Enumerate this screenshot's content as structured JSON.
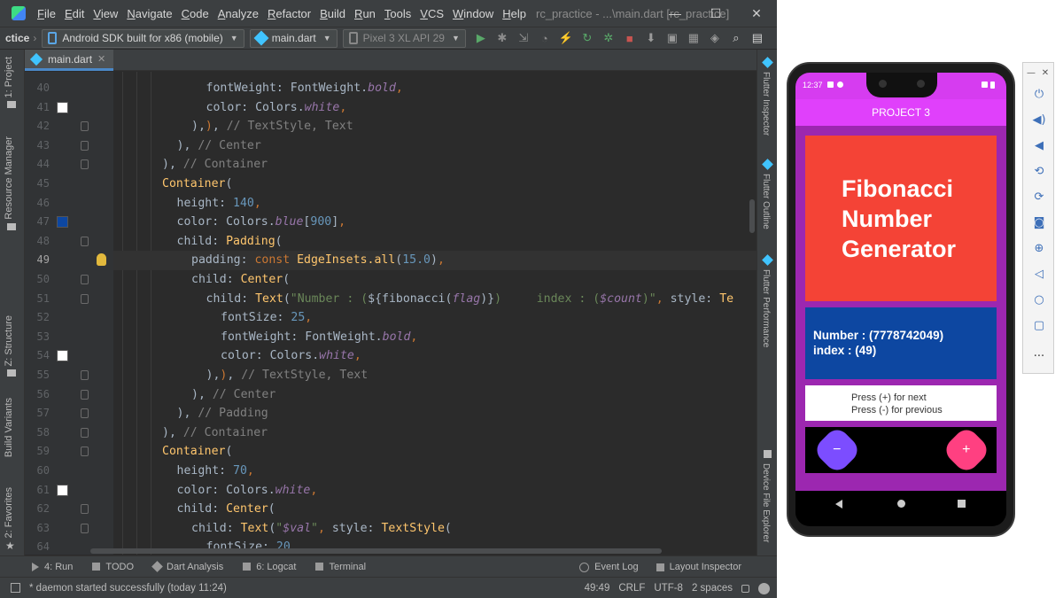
{
  "ide": {
    "menu": [
      "File",
      "Edit",
      "View",
      "Navigate",
      "Code",
      "Analyze",
      "Refactor",
      "Build",
      "Run",
      "Tools",
      "VCS",
      "Window",
      "Help"
    ],
    "window_title": "rc_practice - ...\\main.dart [rc_practice]",
    "window_buttons": {
      "minimize": "—",
      "maximize": "☐",
      "close": "✕"
    },
    "toolbar": {
      "breadcrumb": "ctice",
      "device_target": "Android SDK built for x86 (mobile)",
      "run_config": "main.dart",
      "avd": "Pixel 3 XL API 29",
      "icons": [
        "run-icon",
        "debug-icon",
        "attach-icon",
        "profile-icon",
        "hot-reload-icon",
        "hot-restart-icon",
        "flutter-debug-icon",
        "stop-icon",
        "sdk-manager-icon",
        "avd-manager-icon",
        "project-structure-icon",
        "search-icon",
        "user-icon"
      ]
    },
    "editor_tab": "main.dart",
    "left_tools": [
      "1: Project",
      "Resource Manager",
      "Z: Structure",
      "Build Variants",
      "2: Favorites"
    ],
    "right_tools": [
      "Flutter Inspector",
      "Flutter Outline",
      "Flutter Performance",
      "Device File Explorer"
    ],
    "code_lines": [
      {
        "n": "40",
        "swatch": "",
        "fold": false,
        "bulb": false,
        "cur": false,
        "indent": 4,
        "tokens": [
          {
            "c": "pl",
            "t": "fontWeight: FontWeight."
          },
          {
            "c": "it",
            "t": "bold"
          },
          {
            "c": "kw",
            "t": ","
          }
        ]
      },
      {
        "n": "41",
        "swatch": "#ffffff",
        "fold": false,
        "bulb": false,
        "cur": false,
        "indent": 4,
        "tokens": [
          {
            "c": "pl",
            "t": "color: Colors."
          },
          {
            "c": "it",
            "t": "white"
          },
          {
            "c": "kw",
            "t": ","
          }
        ]
      },
      {
        "n": "42",
        "swatch": "",
        "fold": true,
        "bulb": false,
        "cur": false,
        "indent": 3,
        "tokens": [
          {
            "c": "pl",
            "t": "),"
          },
          {
            "c": "kw",
            "t": ")"
          },
          {
            "c": "pl",
            "t": ","
          },
          {
            "c": "cm",
            "t": " // TextStyle, Text"
          }
        ]
      },
      {
        "n": "43",
        "swatch": "",
        "fold": true,
        "bulb": false,
        "cur": false,
        "indent": 2,
        "tokens": [
          {
            "c": "pl",
            "t": "),"
          },
          {
            "c": "cm",
            "t": " // Center"
          }
        ]
      },
      {
        "n": "44",
        "swatch": "",
        "fold": true,
        "bulb": false,
        "cur": false,
        "indent": 1,
        "tokens": [
          {
            "c": "pl",
            "t": "),"
          },
          {
            "c": "cm",
            "t": " // Container"
          }
        ]
      },
      {
        "n": "45",
        "swatch": "",
        "fold": false,
        "bulb": false,
        "cur": false,
        "indent": 1,
        "tokens": [
          {
            "c": "fn",
            "t": "Container"
          },
          {
            "c": "pl",
            "t": "("
          }
        ]
      },
      {
        "n": "46",
        "swatch": "",
        "fold": false,
        "bulb": false,
        "cur": false,
        "indent": 2,
        "tokens": [
          {
            "c": "pl",
            "t": "height: "
          },
          {
            "c": "num",
            "t": "140"
          },
          {
            "c": "kw",
            "t": ","
          }
        ]
      },
      {
        "n": "47",
        "swatch": "#0d47a1",
        "fold": false,
        "bulb": false,
        "cur": false,
        "indent": 2,
        "tokens": [
          {
            "c": "pl",
            "t": "color: Colors."
          },
          {
            "c": "it",
            "t": "blue"
          },
          {
            "c": "pl",
            "t": "["
          },
          {
            "c": "num",
            "t": "900"
          },
          {
            "c": "pl",
            "t": "]"
          },
          {
            "c": "kw",
            "t": ","
          }
        ]
      },
      {
        "n": "48",
        "swatch": "",
        "fold": true,
        "bulb": false,
        "cur": false,
        "indent": 2,
        "tokens": [
          {
            "c": "pl",
            "t": "child: "
          },
          {
            "c": "fn",
            "t": "Padding"
          },
          {
            "c": "pl",
            "t": "("
          }
        ]
      },
      {
        "n": "49",
        "swatch": "",
        "fold": false,
        "bulb": true,
        "cur": true,
        "indent": 3,
        "tokens": [
          {
            "c": "pl",
            "t": "padding: "
          },
          {
            "c": "kw",
            "t": "const "
          },
          {
            "c": "fn",
            "t": "EdgeInsets.all"
          },
          {
            "c": "pl",
            "t": "("
          },
          {
            "c": "num",
            "t": "15.0"
          },
          {
            "c": "pl",
            "t": ")"
          },
          {
            "c": "kw",
            "t": ","
          }
        ]
      },
      {
        "n": "50",
        "swatch": "",
        "fold": true,
        "bulb": false,
        "cur": false,
        "indent": 3,
        "tokens": [
          {
            "c": "pl",
            "t": "child: "
          },
          {
            "c": "fn",
            "t": "Center"
          },
          {
            "c": "pl",
            "t": "("
          }
        ]
      },
      {
        "n": "51",
        "swatch": "",
        "fold": true,
        "bulb": false,
        "cur": false,
        "indent": 4,
        "tokens": [
          {
            "c": "pl",
            "t": "child: "
          },
          {
            "c": "fn",
            "t": "Text"
          },
          {
            "c": "pl",
            "t": "("
          },
          {
            "c": "str",
            "t": "\"Number : ("
          },
          {
            "c": "pl",
            "t": "${"
          },
          {
            "c": "pl",
            "t": "fibonacci("
          },
          {
            "c": "it",
            "t": "flag"
          },
          {
            "c": "pl",
            "t": ")}"
          },
          {
            "c": "str",
            "t": ")     index : ("
          },
          {
            "c": "it",
            "t": "$count"
          },
          {
            "c": "str",
            "t": ")\""
          },
          {
            "c": "kw",
            "t": ","
          },
          {
            "c": "pl",
            "t": " style: "
          },
          {
            "c": "fn",
            "t": "Te"
          }
        ]
      },
      {
        "n": "52",
        "swatch": "",
        "fold": false,
        "bulb": false,
        "cur": false,
        "indent": 5,
        "tokens": [
          {
            "c": "pl",
            "t": "fontSize: "
          },
          {
            "c": "num",
            "t": "25"
          },
          {
            "c": "kw",
            "t": ","
          }
        ]
      },
      {
        "n": "53",
        "swatch": "",
        "fold": false,
        "bulb": false,
        "cur": false,
        "indent": 5,
        "tokens": [
          {
            "c": "pl",
            "t": "fontWeight: FontWeight."
          },
          {
            "c": "it",
            "t": "bold"
          },
          {
            "c": "kw",
            "t": ","
          }
        ]
      },
      {
        "n": "54",
        "swatch": "#ffffff",
        "fold": false,
        "bulb": false,
        "cur": false,
        "indent": 5,
        "tokens": [
          {
            "c": "pl",
            "t": "color: Colors."
          },
          {
            "c": "it",
            "t": "white"
          },
          {
            "c": "kw",
            "t": ","
          }
        ]
      },
      {
        "n": "55",
        "swatch": "",
        "fold": true,
        "bulb": false,
        "cur": false,
        "indent": 4,
        "tokens": [
          {
            "c": "pl",
            "t": "),"
          },
          {
            "c": "kw",
            "t": ")"
          },
          {
            "c": "pl",
            "t": ","
          },
          {
            "c": "cm",
            "t": " // TextStyle, Text"
          }
        ]
      },
      {
        "n": "56",
        "swatch": "",
        "fold": true,
        "bulb": false,
        "cur": false,
        "indent": 3,
        "tokens": [
          {
            "c": "pl",
            "t": "),"
          },
          {
            "c": "cm",
            "t": " // Center"
          }
        ]
      },
      {
        "n": "57",
        "swatch": "",
        "fold": true,
        "bulb": false,
        "cur": false,
        "indent": 2,
        "tokens": [
          {
            "c": "pl",
            "t": "),"
          },
          {
            "c": "cm",
            "t": " // Padding"
          }
        ]
      },
      {
        "n": "58",
        "swatch": "",
        "fold": true,
        "bulb": false,
        "cur": false,
        "indent": 1,
        "tokens": [
          {
            "c": "pl",
            "t": "),"
          },
          {
            "c": "cm",
            "t": " // Container"
          }
        ]
      },
      {
        "n": "59",
        "swatch": "",
        "fold": true,
        "bulb": false,
        "cur": false,
        "indent": 1,
        "tokens": [
          {
            "c": "fn",
            "t": "Container"
          },
          {
            "c": "pl",
            "t": "("
          }
        ]
      },
      {
        "n": "60",
        "swatch": "",
        "fold": false,
        "bulb": false,
        "cur": false,
        "indent": 2,
        "tokens": [
          {
            "c": "pl",
            "t": "height: "
          },
          {
            "c": "num",
            "t": "70"
          },
          {
            "c": "kw",
            "t": ","
          }
        ]
      },
      {
        "n": "61",
        "swatch": "#ffffff",
        "fold": false,
        "bulb": false,
        "cur": false,
        "indent": 2,
        "tokens": [
          {
            "c": "pl",
            "t": "color: Colors."
          },
          {
            "c": "it",
            "t": "white"
          },
          {
            "c": "kw",
            "t": ","
          }
        ]
      },
      {
        "n": "62",
        "swatch": "",
        "fold": true,
        "bulb": false,
        "cur": false,
        "indent": 2,
        "tokens": [
          {
            "c": "pl",
            "t": "child: "
          },
          {
            "c": "fn",
            "t": "Center"
          },
          {
            "c": "pl",
            "t": "("
          }
        ]
      },
      {
        "n": "63",
        "swatch": "",
        "fold": true,
        "bulb": false,
        "cur": false,
        "indent": 3,
        "tokens": [
          {
            "c": "pl",
            "t": "child: "
          },
          {
            "c": "fn",
            "t": "Text"
          },
          {
            "c": "pl",
            "t": "("
          },
          {
            "c": "str",
            "t": "\""
          },
          {
            "c": "it",
            "t": "$val"
          },
          {
            "c": "str",
            "t": "\""
          },
          {
            "c": "kw",
            "t": ","
          },
          {
            "c": "pl",
            "t": " style: "
          },
          {
            "c": "fn",
            "t": "TextStyle"
          },
          {
            "c": "pl",
            "t": "("
          }
        ]
      },
      {
        "n": "64",
        "swatch": "",
        "fold": false,
        "bulb": false,
        "cur": false,
        "indent": 4,
        "tokens": [
          {
            "c": "pl",
            "t": "fontSize: "
          },
          {
            "c": "num",
            "t": "20"
          },
          {
            "c": "kw",
            "t": ","
          }
        ]
      }
    ],
    "bottom_tools": [
      {
        "label": "4: Run",
        "icon": "run-icon"
      },
      {
        "label": "TODO",
        "icon": "todo-icon"
      },
      {
        "label": "Dart Analysis",
        "icon": "dart-analysis-icon"
      },
      {
        "label": "6: Logcat",
        "icon": "logcat-icon"
      },
      {
        "label": "Terminal",
        "icon": "terminal-icon"
      }
    ],
    "bottom_tools_right": [
      {
        "label": "Event Log",
        "icon": "event-log-icon"
      },
      {
        "label": "Layout Inspector",
        "icon": "layout-inspector-icon"
      }
    ],
    "status": {
      "message": "* daemon started successfully (today 11:24)",
      "position": "49:49",
      "line_sep": "CRLF",
      "encoding": "UTF-8",
      "indent": "2 spaces"
    }
  },
  "phone": {
    "time": "12:37",
    "app_title": "PROJECT 3",
    "title_lines": [
      "Fibonacci",
      "Number",
      "Generator"
    ],
    "number_line": "Number : (7778742049)",
    "index_line": "index : (49)",
    "hint_lines": [
      "Press (+) for next",
      "Press (-) for previous"
    ],
    "minus_label": "−",
    "plus_label": "+",
    "colors": {
      "appbar": "#e040fb",
      "body": "#9c27b0",
      "title_box": "#f44336",
      "fib_box": "#0d47a1"
    }
  },
  "emulator_panel": {
    "close": "✕",
    "minimize": "—",
    "buttons": [
      "power-icon",
      "volume-up-icon",
      "volume-down-icon",
      "rotate-left-icon",
      "rotate-right-icon",
      "screenshot-icon",
      "zoom-icon",
      "back-icon",
      "home-icon",
      "overview-icon",
      "more-icon"
    ],
    "more_label": "..."
  }
}
